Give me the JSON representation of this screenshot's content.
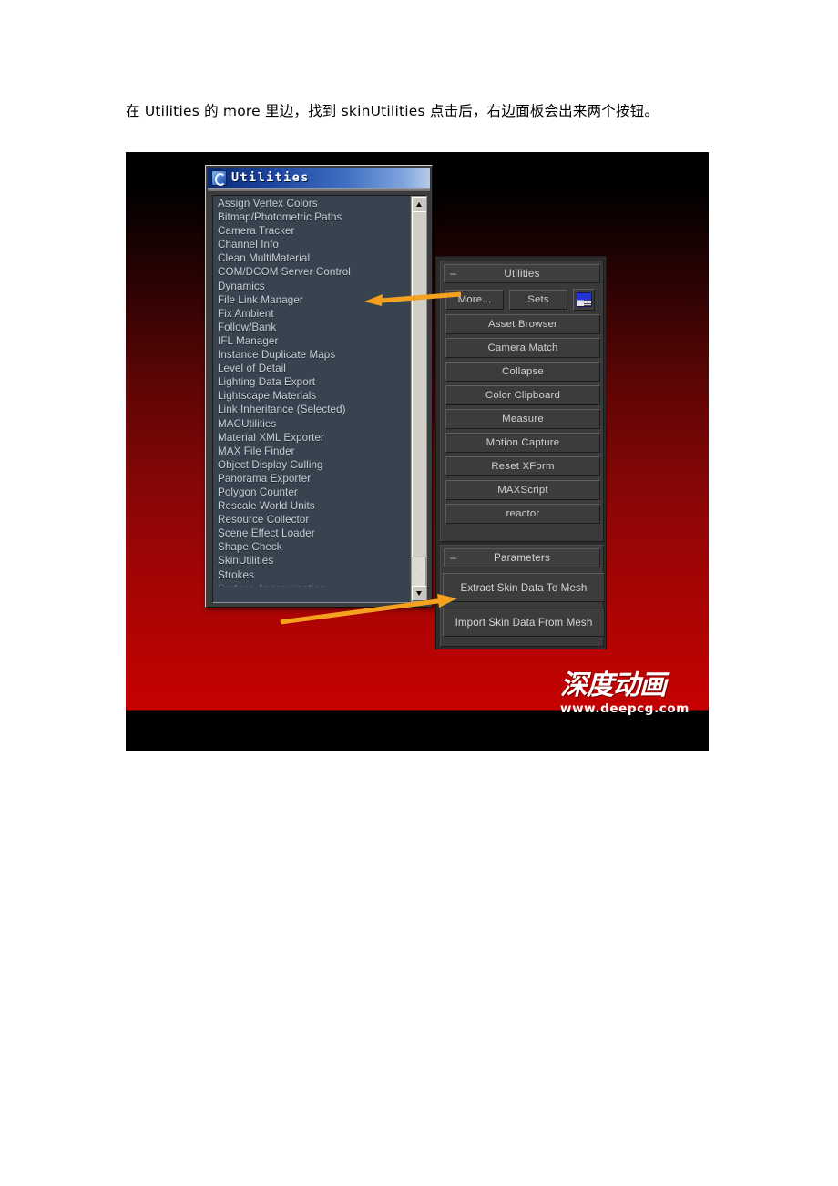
{
  "document": {
    "paragraph": "在 Utilities 的 more 里边，找到 skinUtilities 点击后，右边面板会出来两个按钮。"
  },
  "screenshot": {
    "dialog": {
      "title": "Utilities",
      "title_icon": "max-logo-icon",
      "list": {
        "items": [
          "Assign Vertex Colors",
          "Bitmap/Photometric Paths",
          "Camera Tracker",
          "Channel Info",
          "Clean MultiMaterial",
          "COM/DCOM Server Control",
          "Dynamics",
          "File Link Manager",
          "Fix Ambient",
          "Follow/Bank",
          "IFL Manager",
          "Instance Duplicate Maps",
          "Level of Detail",
          "Lighting Data Export",
          "Lightscape Materials",
          "Link Inheritance (Selected)",
          "MACUtilities",
          "Material XML Exporter",
          "MAX File Finder",
          "Object Display Culling",
          "Panorama Exporter",
          "Polygon Counter",
          "Rescale World Units",
          "Resource Collector",
          "Scene Effect Loader",
          "Shape Check",
          "SkinUtilities",
          "Strokes"
        ],
        "partial_item": "Surface Approximation"
      },
      "scrollbar": {
        "up_icon": "scroll-up-arrow-icon",
        "down_icon": "scroll-down-arrow-icon"
      }
    },
    "command_panel": {
      "rollouts": [
        {
          "title": "Utilities",
          "collapse_symbol": "–",
          "top_buttons": [
            {
              "label": "More...",
              "name": "more-button"
            },
            {
              "label": "Sets",
              "name": "sets-button"
            }
          ],
          "icon_button": "configure-button-sets-icon",
          "buttons": [
            "Asset Browser",
            "Camera Match",
            "Collapse",
            "Color Clipboard",
            "Measure",
            "Motion Capture",
            "Reset XForm",
            "MAXScript",
            "reactor"
          ]
        },
        {
          "title": "Parameters",
          "collapse_symbol": "–",
          "buttons": [
            "Extract Skin Data To Mesh",
            "Import Skin Data From Mesh"
          ]
        }
      ]
    },
    "annotations": {
      "arrow_color": "#f5a01e",
      "arrow_1": "points-left-to-utilities-list",
      "arrow_2": "points-right-to-extract-skin-data-button"
    },
    "watermark": {
      "logo_text": "深度动画",
      "url": "www.deepcg.com",
      "accent_color": "#c00000"
    },
    "background": {
      "gradient_from": "#000000",
      "gradient_to": "#c60101"
    }
  }
}
